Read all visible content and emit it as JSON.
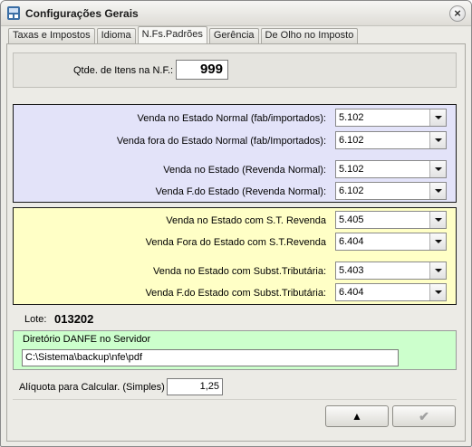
{
  "window": {
    "title": "Configurações Gerais",
    "close_glyph": "×"
  },
  "tabs": [
    {
      "label": "Taxas e Impostos"
    },
    {
      "label": "Idioma"
    },
    {
      "label": "N.Fs.Padrões"
    },
    {
      "label": "Gerência"
    },
    {
      "label": "De Olho no Imposto"
    }
  ],
  "active_tab": "N.Fs.Padrões",
  "qtd_itens": {
    "label": "Qtde. de Itens na N.F.:",
    "value": "999"
  },
  "cfop_normal": [
    {
      "label": "Venda no Estado Normal (fab/importados):",
      "value": "5.102"
    },
    {
      "label": "Venda fora do Estado Normal (fab/Importados):",
      "value": "6.102"
    },
    {
      "label": "Venda no Estado (Revenda Normal):",
      "value": "5.102"
    },
    {
      "label": "Venda F.do Estado (Revenda Normal):",
      "value": "6.102"
    }
  ],
  "cfop_st": [
    {
      "label": "Venda no Estado com S.T. Revenda",
      "value": "5.405"
    },
    {
      "label": "Venda Fora do Estado com S.T.Revenda",
      "value": "6.404"
    },
    {
      "label": "Venda no Estado com Subst.Tributária:",
      "value": "5.403"
    },
    {
      "label": "Venda F.do Estado com Subst.Tributária:",
      "value": "6.404"
    }
  ],
  "lote": {
    "label": "Lote:",
    "value": "013202"
  },
  "danfe": {
    "label": "Diretório DANFE no Servidor",
    "value": "C:\\Sistema\\backup\\nfe\\pdf"
  },
  "aliquota": {
    "label": "Alíquota para Calcular. (Simples)",
    "value": "1,25"
  },
  "buttons": {
    "up_glyph": "▲",
    "ok_glyph": "✔"
  },
  "colors": {
    "blue_panel": "#e3e3f9",
    "yellow_panel": "#ffffc6",
    "green_panel": "#ccffcc"
  },
  "icons": {
    "app": "app-logo-icon",
    "close": "close-icon",
    "dropdown": "chevron-down-icon",
    "up": "arrow-up-icon",
    "ok": "checkmark-icon"
  }
}
